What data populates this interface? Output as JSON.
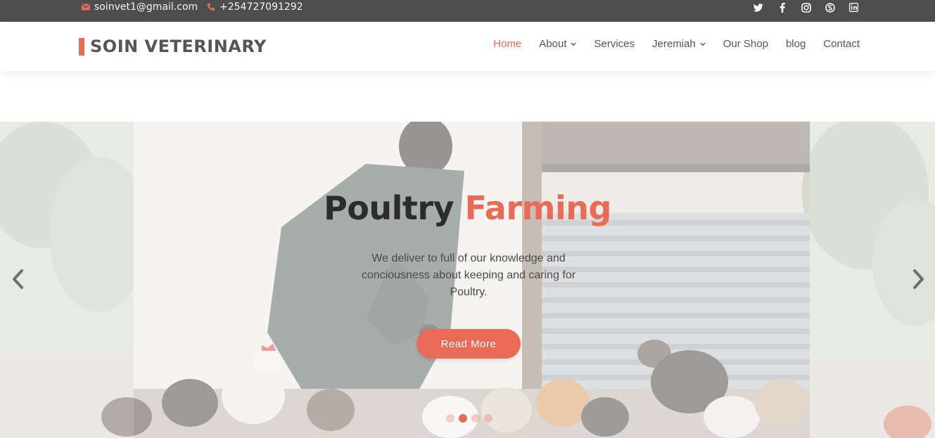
{
  "topbar": {
    "email": "soinvet1@gmail.com",
    "phone": "+254727091292",
    "icons": {
      "email": "envelope-icon",
      "phone": "phone-icon"
    },
    "socials": [
      "twitter-icon",
      "facebook-icon",
      "instagram-icon",
      "skype-icon",
      "linkedin-icon"
    ]
  },
  "header": {
    "logo": "SOIN VETERINARY",
    "nav": [
      {
        "label": "Home",
        "active": true
      },
      {
        "label": "About",
        "dropdown": true
      },
      {
        "label": "Services"
      },
      {
        "label": "Jeremiah",
        "dropdown": true
      },
      {
        "label": "Our Shop"
      },
      {
        "label": "blog"
      },
      {
        "label": "Contact"
      }
    ]
  },
  "hero": {
    "title_main": "Poultry",
    "title_accent": "Farming",
    "subtitle": "We deliver to full of our knowledge and conciousness about keeping and caring for Poultry.",
    "button": "Read More",
    "prev_icon": "chevron-left-icon",
    "next_icon": "chevron-right-icon",
    "slides_count": 4,
    "active_slide": 2
  },
  "colors": {
    "accent": "#e96b56",
    "topbar": "#4d4d4d",
    "text": "#555555"
  }
}
